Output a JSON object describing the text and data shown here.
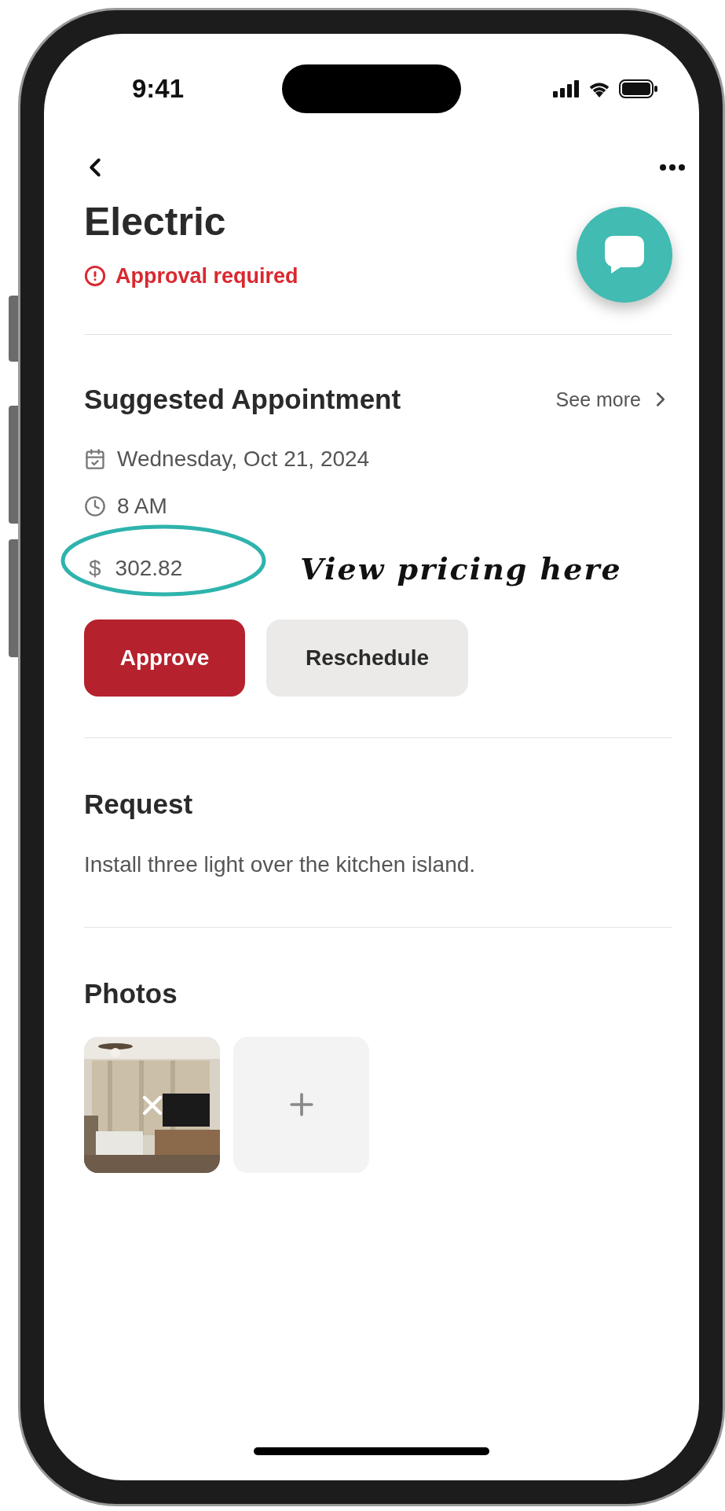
{
  "status_bar": {
    "time": "9:41"
  },
  "header": {
    "title": "Electric",
    "status": "Approval required"
  },
  "appointment": {
    "heading": "Suggested Appointment",
    "see_more": "See more",
    "date": "Wednesday, Oct 21, 2024",
    "time": "8 AM",
    "currency": "$",
    "price": "302.82",
    "actions": [
      {
        "label": "Approve",
        "kind": "primary"
      },
      {
        "label": "Reschedule",
        "kind": "secondary"
      }
    ]
  },
  "annotation": {
    "text": "View pricing here"
  },
  "request": {
    "heading": "Request",
    "text": "Install three light over the kitchen island."
  },
  "photos": {
    "heading": "Photos",
    "items": [
      {
        "kind": "picture"
      },
      {
        "kind": "add"
      }
    ]
  }
}
